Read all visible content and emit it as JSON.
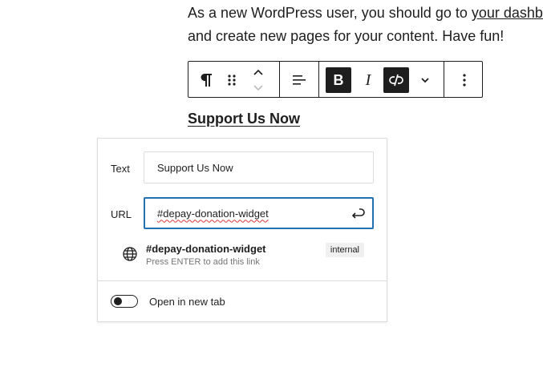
{
  "content": {
    "paragraph_line1_prefix": "As a new WordPress user, you should go to ",
    "paragraph_link": "your dashbo",
    "paragraph_line2": "and create new pages for your content. Have fun!",
    "link_text": "Support Us Now"
  },
  "toolbar": {
    "icons": [
      "paragraph-icon",
      "drag-handle-icon",
      "move-up-down-icon",
      "align-icon",
      "bold-icon",
      "italic-icon",
      "unlink-icon",
      "more-formatting-icon",
      "options-icon"
    ],
    "bold_label": "B",
    "italic_label": "I"
  },
  "link_popover": {
    "text_label": "Text",
    "text_value": "Support Us Now",
    "url_label": "URL",
    "url_value": "#depay-donation-widget",
    "suggestion": {
      "title": "#depay-donation-widget",
      "subtitle": "Press ENTER to add this link",
      "badge": "internal"
    },
    "new_tab_label": "Open in new tab",
    "new_tab_enabled": false
  },
  "colors": {
    "text": "#1e1e1e",
    "focus_border": "#2271b1",
    "muted": "#757575",
    "spellcheck": "#d63638"
  }
}
